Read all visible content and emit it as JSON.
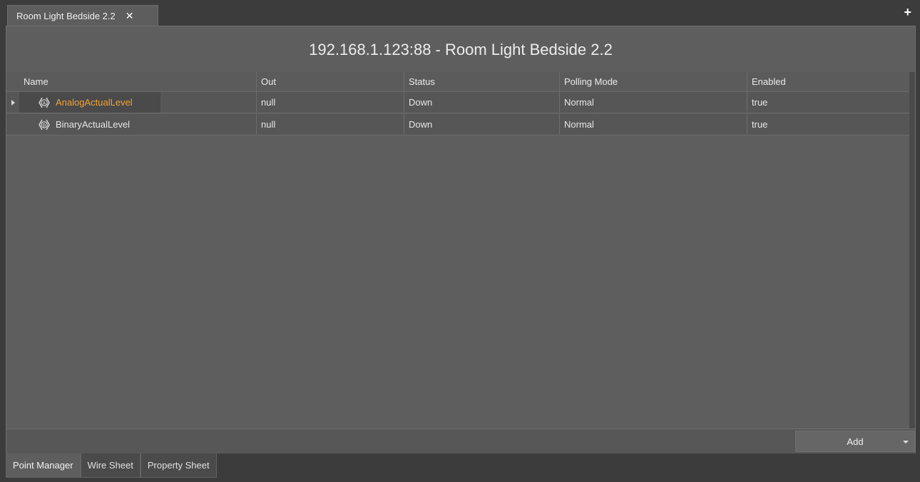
{
  "tab": {
    "title": "Room Light Bedside 2.2",
    "close_glyph": "✕",
    "new_tab_glyph": "+"
  },
  "header": {
    "title": "192.168.1.123:88 - Room Light Bedside 2.2"
  },
  "table": {
    "columns": [
      "Name",
      "Out",
      "Status",
      "Polling Mode",
      "Enabled"
    ],
    "rows": [
      {
        "icon": "analog-point-icon",
        "icon_letter": "A",
        "name": "AnalogActualLevel",
        "out": "null",
        "status": "Down",
        "polling_mode": "Normal",
        "enabled": "true",
        "selected": true
      },
      {
        "icon": "binary-point-icon",
        "icon_letter": "B",
        "name": "BinaryActualLevel",
        "out": "null",
        "status": "Down",
        "polling_mode": "Normal",
        "enabled": "true",
        "selected": false
      }
    ]
  },
  "toolbar": {
    "add_label": "Add"
  },
  "view_tabs": [
    "Point Manager",
    "Wire Sheet",
    "Property Sheet"
  ],
  "colors": {
    "accent_orange": "#f2a233",
    "panel": "#5e5e5e",
    "background": "#3c3c3c"
  }
}
